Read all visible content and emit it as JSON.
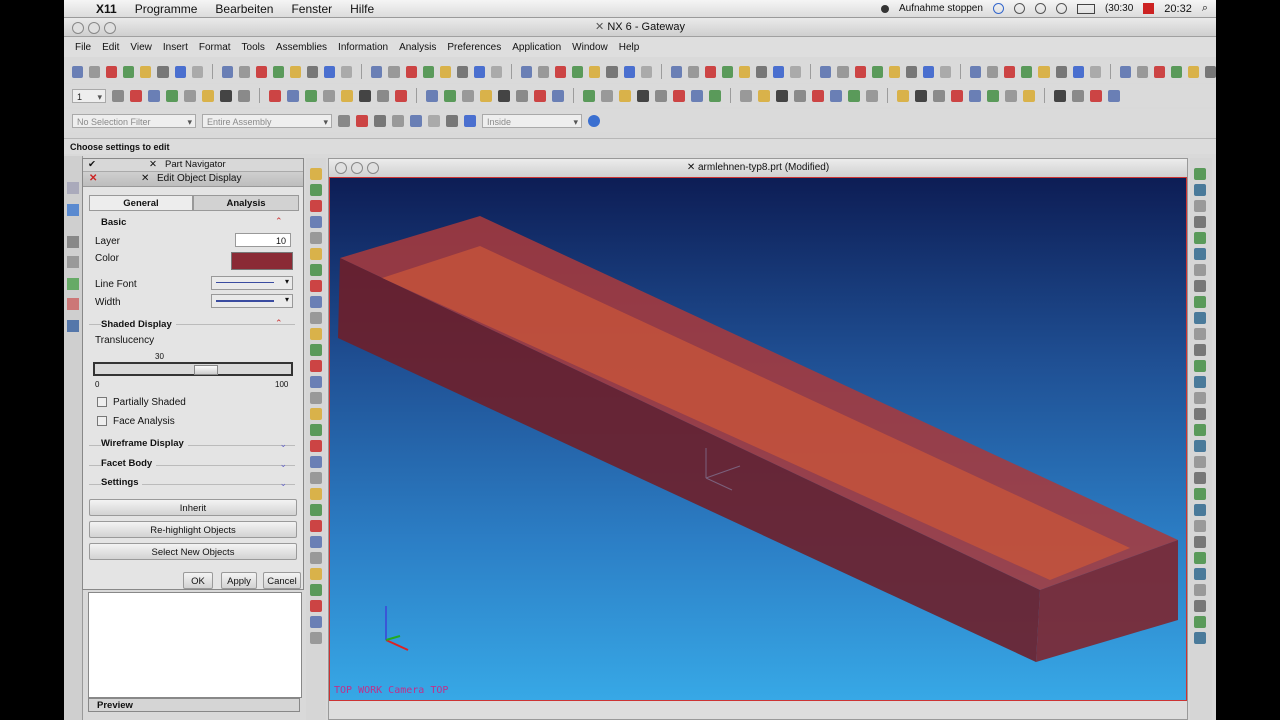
{
  "mac_menubar": {
    "app_name": "X11",
    "items": [
      "Programme",
      "Bearbeiten",
      "Fenster",
      "Hilfe"
    ],
    "recording_label": "Aufnahme stoppen",
    "battery": "(30:30",
    "clock": "20:32"
  },
  "window": {
    "title": "NX 6 - Gateway"
  },
  "app_menu": {
    "items": [
      "File",
      "Edit",
      "View",
      "Insert",
      "Format",
      "Tools",
      "Assemblies",
      "Information",
      "Analysis",
      "Preferences",
      "Application",
      "Window",
      "Help"
    ]
  },
  "selection_bar": {
    "layer_value": "1",
    "filter": "No Selection Filter",
    "assembly": "Entire Assembly",
    "inside": "Inside"
  },
  "cue_line": "Choose settings to edit",
  "navigator": {
    "part_navigator": "Part Navigator",
    "dialog_title": "Edit Object Display"
  },
  "dialog": {
    "tabs": [
      "General",
      "Analysis"
    ],
    "basic_label": "Basic",
    "layer_label": "Layer",
    "layer_value": "10",
    "color_label": "Color",
    "color_value": "#8a2a35",
    "line_font_label": "Line Font",
    "width_label": "Width",
    "shaded_display_label": "Shaded Display",
    "translucency_label": "Translucency",
    "translucency_value": "30",
    "translucency_fraction": 0.3,
    "slider_min": "0",
    "slider_max": "100",
    "partially_shaded_label": "Partially Shaded",
    "face_analysis_label": "Face Analysis",
    "wireframe_display_label": "Wireframe Display",
    "facet_body_label": "Facet Body",
    "settings_label": "Settings",
    "inherit_button": "Inherit",
    "rehighlight_button": "Re-highlight Objects",
    "select_new_button": "Select New Objects",
    "ok_button": "OK",
    "apply_button": "Apply",
    "cancel_button": "Cancel"
  },
  "preview_label": "Preview",
  "viewport": {
    "title": "armlehnen-typ8.prt (Modified)",
    "view_label": "TOP  WORK  Camera  TOP"
  }
}
